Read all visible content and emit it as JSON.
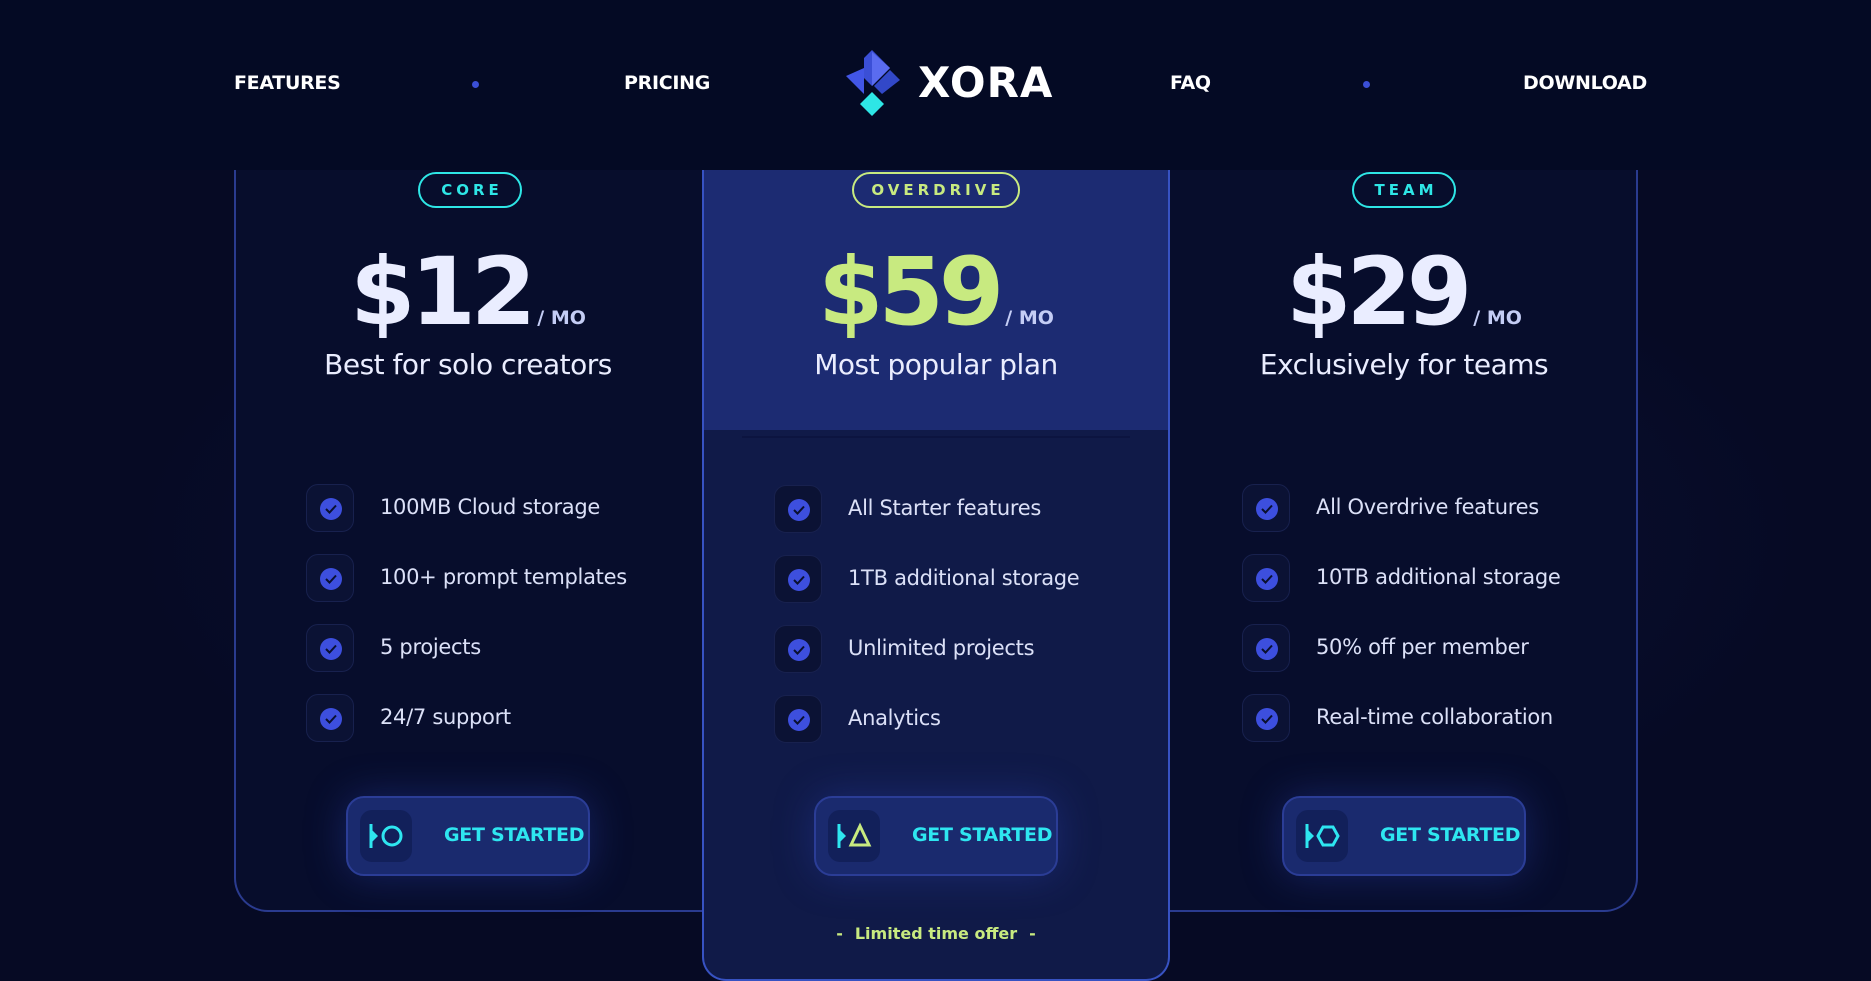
{
  "nav": {
    "left": [
      "FEATURES",
      "PRICING"
    ],
    "right": [
      "FAQ",
      "DOWNLOAD"
    ],
    "logo_text": "XORA"
  },
  "plans": [
    {
      "badge": "CORE",
      "price": "$12",
      "unit": "/ MO",
      "tagline": "Best for solo creators",
      "features": [
        "100MB Cloud storage",
        "100+ prompt templates",
        "5 projects",
        "24/7 support"
      ],
      "cta": "GET STARTED",
      "cta_icon": "circle-icon"
    },
    {
      "badge": "OVERDRIVE",
      "price": "$59",
      "unit": "/ MO",
      "tagline": "Most popular plan",
      "features": [
        "All Starter features",
        "1TB additional storage",
        "Unlimited projects",
        "Analytics"
      ],
      "cta": "GET STARTED",
      "cta_icon": "triangle-icon",
      "offer": "Limited time offer",
      "offer_dash": "-"
    },
    {
      "badge": "TEAM",
      "price": "$29",
      "unit": "/ MO",
      "tagline": "Exclusively for teams",
      "features": [
        "All Overdrive features",
        "10TB additional storage",
        "50% off per member",
        "Real-time collaboration"
      ],
      "cta": "GET STARTED",
      "cta_icon": "hexagon-icon"
    }
  ],
  "colors": {
    "background": "#060a24",
    "accent_cyan": "#2ee6e6",
    "accent_lime": "#c8ea80",
    "check_blue": "#3d4fde",
    "popular_card": "#1c2b72"
  }
}
